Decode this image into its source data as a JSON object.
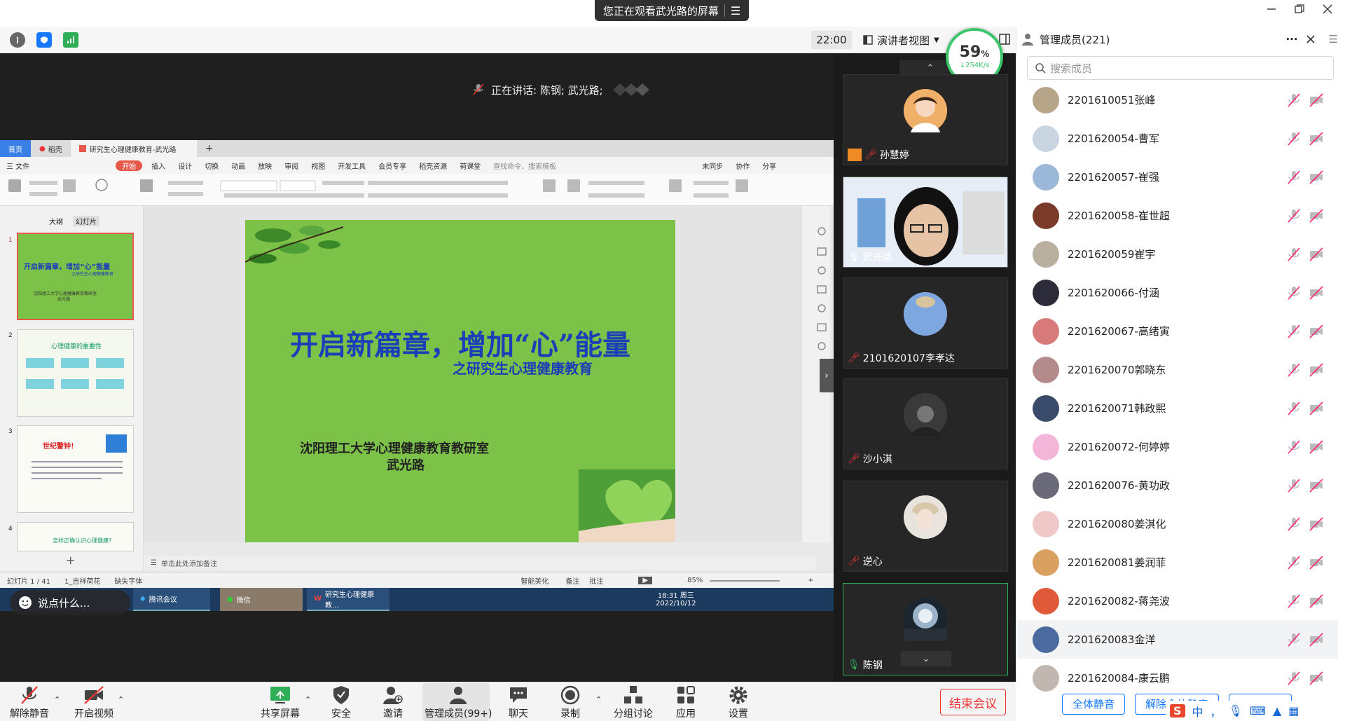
{
  "banner": {
    "text": "您正在观看武光路的屏幕"
  },
  "toolbar": {
    "time": "22:00",
    "view_label": "演讲者视图"
  },
  "network": {
    "percent": "59",
    "unit": "%",
    "speed": "254K/s"
  },
  "speaking": {
    "text": "正在讲话: 陈钢; 武光路;"
  },
  "shared": {
    "tabs": [
      "首页",
      "稻壳",
      "研究生心理健康教育-武光路"
    ],
    "menu": [
      "三 文件",
      "开始",
      "插入",
      "设计",
      "切换",
      "动画",
      "放映",
      "审阅",
      "视图",
      "开发工具",
      "会员专享",
      "稻壳资源",
      "荷课堂",
      "查找命令、搜索模板",
      "未同步",
      "协作",
      "分享"
    ],
    "panel_tabs": [
      "大纲",
      "幻灯片"
    ],
    "thumbs": [
      {
        "num": "1",
        "title": "开启新篇章，增加“心”能量",
        "sub": "之研究生心理健康教育",
        "org": "沈阳理工大学心理健康教育教研室",
        "author": "武光路"
      },
      {
        "num": "2",
        "title": "心理健康的重要性"
      },
      {
        "num": "3",
        "title": "世纪警钟！"
      },
      {
        "num": "4",
        "title": "怎样正确认识心理健康?"
      }
    ],
    "slide": {
      "title": "开启新篇章，增加“心”能量",
      "subtitle": "之研究生心理健康教育",
      "org": "沈阳理工大学心理健康教育教研室",
      "author": "武光路"
    },
    "note_placeholder": "单击此处添加备注",
    "status": {
      "slide_count": "幻灯片 1 / 41",
      "theme": "1_吉祥荷花",
      "font_missing": "缺失字体",
      "beautify": "智能美化",
      "notes": "备注",
      "comments": "批注",
      "zoom": "85%"
    },
    "taskbar": {
      "apps": [
        "腾讯会议",
        "微信",
        "研究生心理健康教..."
      ],
      "time": "18:31 周三",
      "date": "2022/10/12"
    }
  },
  "chat_input": {
    "placeholder": "说点什么..."
  },
  "gallery": {
    "tiles": [
      {
        "name": "孙慧婷"
      },
      {
        "name": "武光路"
      },
      {
        "name": "2101620107李孝达"
      },
      {
        "name": "沙小淇"
      },
      {
        "name": "逆心"
      },
      {
        "name": "陈钢"
      }
    ]
  },
  "panel": {
    "title": "管理成员(221)",
    "search_placeholder": "搜索成员",
    "members": [
      "2201610051张峰",
      "2201620054-曹军",
      "2201620057-崔强",
      "2201620058-崔世超",
      "2201620059崔宇",
      "2201620066-付涵",
      "2201620067-高绪寅",
      "2201620070郭晓东",
      "2201620071韩政熙",
      "2201620072-何婷婷",
      "2201620076-黄功政",
      "2201620080姜淇化",
      "2201620081姜润菲",
      "2201620082-蒋尧波",
      "2201620083金洋",
      "2201620084-康云鹏"
    ],
    "footer": {
      "mute_all": "全体静音",
      "unmute_all": "解除全体静音"
    }
  },
  "bottom": {
    "unmute": "解除静音",
    "video": "开启视频",
    "share": "共享屏幕",
    "security": "安全",
    "invite": "邀请",
    "members": "管理成员(99+)",
    "chat": "聊天",
    "record": "录制",
    "breakout": "分组讨论",
    "apps": "应用",
    "settings": "设置",
    "end": "结束会议"
  },
  "ime": {
    "items": [
      "中",
      "，"
    ]
  },
  "colors": {
    "accent": "#1677ff",
    "end": "#e33333",
    "slide_bg": "#7cc248",
    "slide_title": "#1a3fb8",
    "active_green": "#2fae57"
  }
}
